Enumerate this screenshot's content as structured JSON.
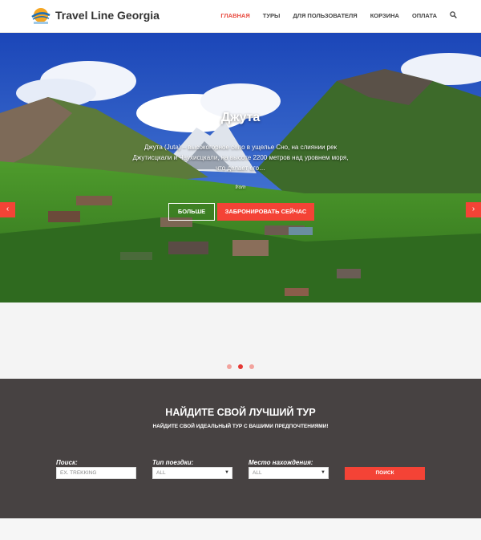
{
  "header": {
    "brand": "Travel Line Georgia",
    "logo_icon": "sun-globe-logo-icon",
    "nav": [
      {
        "label": "ГЛАВНАЯ",
        "active": true
      },
      {
        "label": "ТУРЫ",
        "active": false
      },
      {
        "label": "ДЛЯ ПОЛЬЗОВАТЕЛЯ",
        "active": false
      },
      {
        "label": "КОРЗИНА",
        "active": false
      },
      {
        "label": "ОПЛАТА",
        "active": false
      }
    ],
    "search_icon": "search-icon"
  },
  "hero": {
    "title": "Джута",
    "description": "Джута (Juta) – высокогорное село в ущелье Сно, на слиянии рек Джутисцкали и Чаухисцкали, на высоте 2200 метров над уровнем моря, что делает его…",
    "from_label": "from",
    "more_button": "БОЛЬШЕ",
    "book_button": "ЗАБРОНИРОВАТЬ СЕЙЧАС",
    "prev_icon": "chevron-left-icon",
    "next_icon": "chevron-right-icon"
  },
  "carousel": {
    "dot_count": 3,
    "active_index": 1
  },
  "search": {
    "title": "НАЙДИТЕ СВОЙ ЛУЧШИЙ ТУР",
    "subtitle": "НАЙДИТЕ СВОЙ ИДЕАЛЬНЫЙ ТУР С ВАШИМИ ПРЕДПОЧТЕНИЯМИ!",
    "search_label": "Поиск:",
    "search_placeholder": "EX. TREKKING",
    "type_label": "Тип поездки:",
    "type_value": "ALL",
    "location_label": "Место нахождения:",
    "location_value": "ALL",
    "submit": "ПОИСК"
  },
  "colors": {
    "accent": "#f44336",
    "nav_active": "#e84a3f",
    "search_bg": "#474242"
  }
}
